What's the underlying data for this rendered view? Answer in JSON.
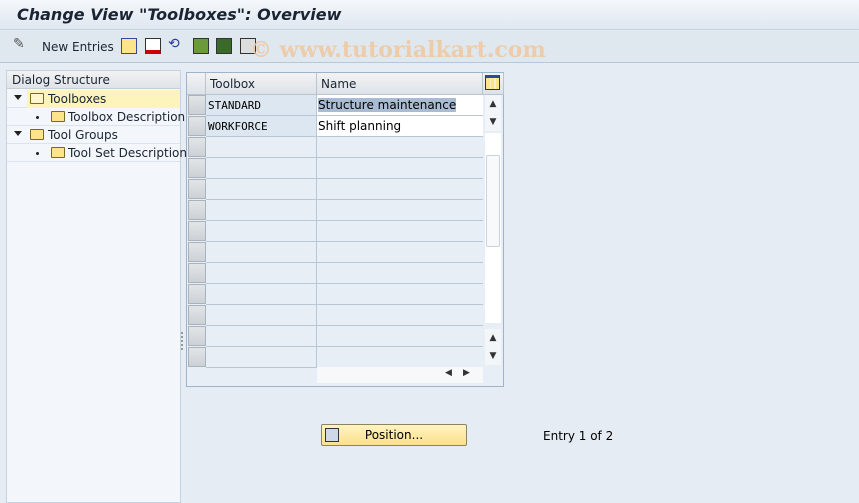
{
  "window": {
    "title": "Change View \"Toolboxes\": Overview"
  },
  "toolbar": {
    "new_entries": "New Entries",
    "watermark": "© www.tutorialkart.com"
  },
  "dialog_structure": {
    "title": "Dialog Structure",
    "nodes": [
      {
        "label": "Toolboxes",
        "level": 0,
        "expanded": true,
        "selected": true
      },
      {
        "label": "Toolbox Description",
        "level": 1
      },
      {
        "label": "Tool Groups",
        "level": 0,
        "expanded": true
      },
      {
        "label": "Tool Set Description",
        "level": 1
      }
    ]
  },
  "table": {
    "columns": [
      "Toolbox",
      "Name"
    ],
    "rows": [
      {
        "toolbox": "STANDARD",
        "name": "Structure maintenance"
      },
      {
        "toolbox": "WORKFORCE",
        "name": "Shift planning"
      }
    ]
  },
  "footer": {
    "position_button": "Position...",
    "entry_text": "Entry 1 of 2"
  }
}
